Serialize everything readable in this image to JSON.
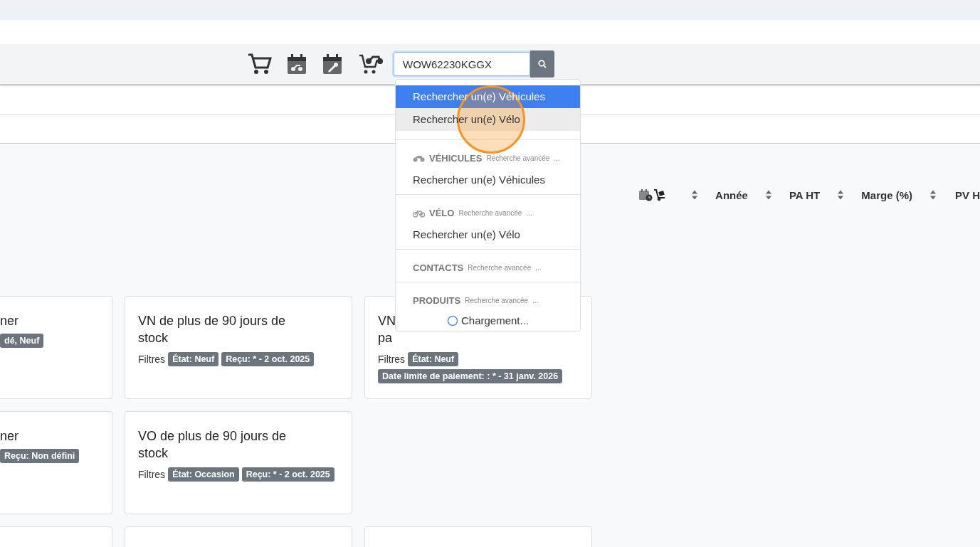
{
  "search": {
    "value": "WOW62230KGGX"
  },
  "dropdown": {
    "quick_items": [
      {
        "label": "Rechercher un(e) Véhicules",
        "selected": true,
        "hover": false
      },
      {
        "label": "Rechercher un(e) Vélo",
        "selected": false,
        "hover": true
      }
    ],
    "sections": [
      {
        "kind": "moto",
        "title": "VÉHICULES",
        "hint": "Recherche avancée",
        "more": "...",
        "items": [
          "Rechercher un(e) Véhicules"
        ]
      },
      {
        "kind": "bike",
        "title": "VÉLO",
        "hint": "Recherche avancée",
        "more": "...",
        "items": [
          "Rechercher un(e) Vélo"
        ]
      },
      {
        "kind": "plain",
        "title": "CONTACTS",
        "hint": "Recherche avancée",
        "more": "..."
      },
      {
        "kind": "plain",
        "title": "PRODUITS",
        "hint": "Recherche avancée",
        "more": "...",
        "loading": "Chargement..."
      }
    ]
  },
  "table_header": {
    "columns": [
      {
        "kind": "icons",
        "sortable": true
      },
      {
        "kind": "text",
        "label": "Année",
        "sortable": true
      },
      {
        "kind": "text",
        "label": "PA HT",
        "sortable": true
      },
      {
        "kind": "text",
        "label": "Marge (%)",
        "sortable": true
      },
      {
        "kind": "text",
        "label": "PV H",
        "sortable": false
      }
    ]
  },
  "card_rows": [
    [
      {
        "kind": "clipped",
        "title_lines": [
          "ner"
        ],
        "badges": [
          "dé, Neuf"
        ]
      },
      {
        "kind": "full",
        "title_lines": [
          "VN de plus de 90 jours de",
          "stock"
        ],
        "filters_label": "Filtres",
        "badges": [
          "État: Neuf",
          "Reçu: * - 2 oct. 2025"
        ]
      },
      {
        "kind": "full",
        "title_lines": [
          "VN",
          "pa"
        ],
        "filters_label": "Filtres",
        "badges": [
          "État: Neuf",
          "Date limite de paiement: : * - 31 janv. 2026"
        ]
      }
    ],
    [
      {
        "kind": "clipped",
        "title_lines": [
          "ner"
        ],
        "badges": [
          "Reçu: Non défini"
        ]
      },
      {
        "kind": "full",
        "title_lines": [
          "VO de plus de 90 jours de",
          "stock"
        ],
        "filters_label": "Filtres",
        "badges": [
          "État: Occasion",
          "Reçu: * - 2 oct. 2025"
        ]
      }
    ],
    [
      {
        "kind": "clipped"
      },
      {
        "kind": "full"
      },
      {
        "kind": "full"
      }
    ]
  ]
}
